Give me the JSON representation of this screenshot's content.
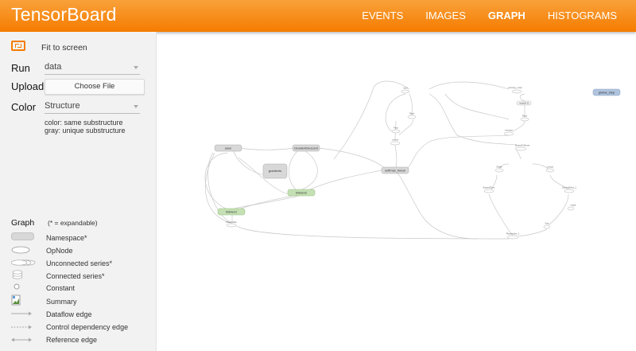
{
  "app": {
    "title": "TensorBoard"
  },
  "tabs": [
    {
      "label": "EVENTS",
      "active": false
    },
    {
      "label": "IMAGES",
      "active": false
    },
    {
      "label": "GRAPH",
      "active": true
    },
    {
      "label": "HISTOGRAMS",
      "active": false
    }
  ],
  "sidebar": {
    "fit_label": "Fit to screen",
    "run_label": "Run",
    "run_value": "data",
    "upload_label": "Upload",
    "choose_file": "Choose File",
    "color_label": "Color",
    "color_value": "Structure",
    "hint_same": "color: same substructure",
    "hint_gray": "gray: unique substructure",
    "graph_title": "Graph",
    "graph_sub": "(* = expandable)",
    "legend": [
      {
        "icon": "namespace-icon",
        "label": "Namespace*"
      },
      {
        "icon": "opnode-icon",
        "label": "OpNode"
      },
      {
        "icon": "unconnected-series-icon",
        "label": "Unconnected series*"
      },
      {
        "icon": "connected-series-icon",
        "label": "Connected series*"
      },
      {
        "icon": "constant-icon",
        "label": "Constant"
      },
      {
        "icon": "summary-icon",
        "label": "Summary"
      },
      {
        "icon": "dataflow-edge-icon",
        "label": "Dataflow edge"
      },
      {
        "icon": "control-dependency-edge-icon",
        "label": "Control dependency edge"
      },
      {
        "icon": "reference-edge-icon",
        "label": "Reference edge"
      }
    ]
  },
  "graph": {
    "nodes": {
      "save": "save",
      "gradients": "gradients",
      "hidden1": "hidden1",
      "hidden2": "hidden2",
      "softmax": "softmax_linear",
      "gd": "GradientDescent",
      "global_step": "global_step",
      "range": "range[0-1]",
      "sum": "Sum",
      "rank": "Rank",
      "pack": "Pack",
      "concat": "concat",
      "xent": "xentropy",
      "sparse": "SparseToDense",
      "placeholder": "Placeholder",
      "placeholder1": "Placeholder_1",
      "expand1": "ExpandDims",
      "expand2": "ExpandDims_1",
      "range2": "range",
      "size": "Size",
      "reshape": "Reshape",
      "concat2": "concat",
      "xent_mean": "xentropy_mean",
      "shape": "Shape"
    }
  },
  "colors": {
    "accent": "#f57c00",
    "namespace_gray": "#d8d8d8",
    "namespace_green": "#c5e0b4",
    "global_step_blue": "#b0c4de"
  }
}
